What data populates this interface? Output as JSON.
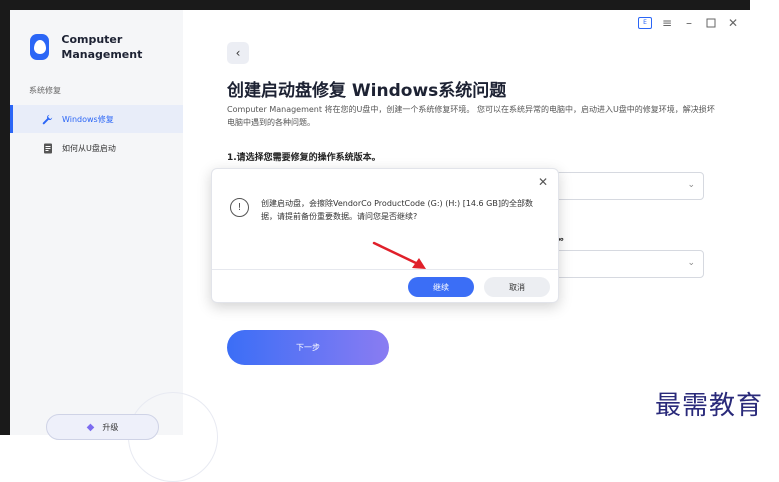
{
  "app": {
    "name": "Computer Management"
  },
  "sidebar": {
    "section_label": "系统修复",
    "items": [
      {
        "label": "Windows修复",
        "icon": "wrench-icon",
        "active": true
      },
      {
        "label": "如何从U盘启动",
        "icon": "document-icon",
        "active": false
      }
    ],
    "upgrade_label": "升级"
  },
  "titlebar": {
    "icons": [
      "feedback-icon",
      "menu-icon",
      "minimize-icon",
      "maximize-icon",
      "close-icon"
    ]
  },
  "main": {
    "title": "创建启动盘修复 Windows系统问题",
    "description": "Computer Management 将在您的U盘中，创建一个系统修复环境。 您可以在系统异常的电脑中，启动进入U盘中的修复环境，解决损坏电脑中遇到的各种问题。",
    "step1_label": "1.请选择您需要修复的操作系统版本。",
    "step2_tail": "机。",
    "next_label": "下一步"
  },
  "dialog": {
    "message": "创建启动盘，会擦除VendorCo ProductCode (G:) (H:) [14.6 GB]的全部数据，请提前备份重要数据。请问您是否继续?",
    "confirm_label": "继续",
    "cancel_label": "取消"
  },
  "watermark": {
    "text": "最需教育"
  },
  "colors": {
    "accent": "#2b66f6",
    "arrow": "#e0202a"
  }
}
